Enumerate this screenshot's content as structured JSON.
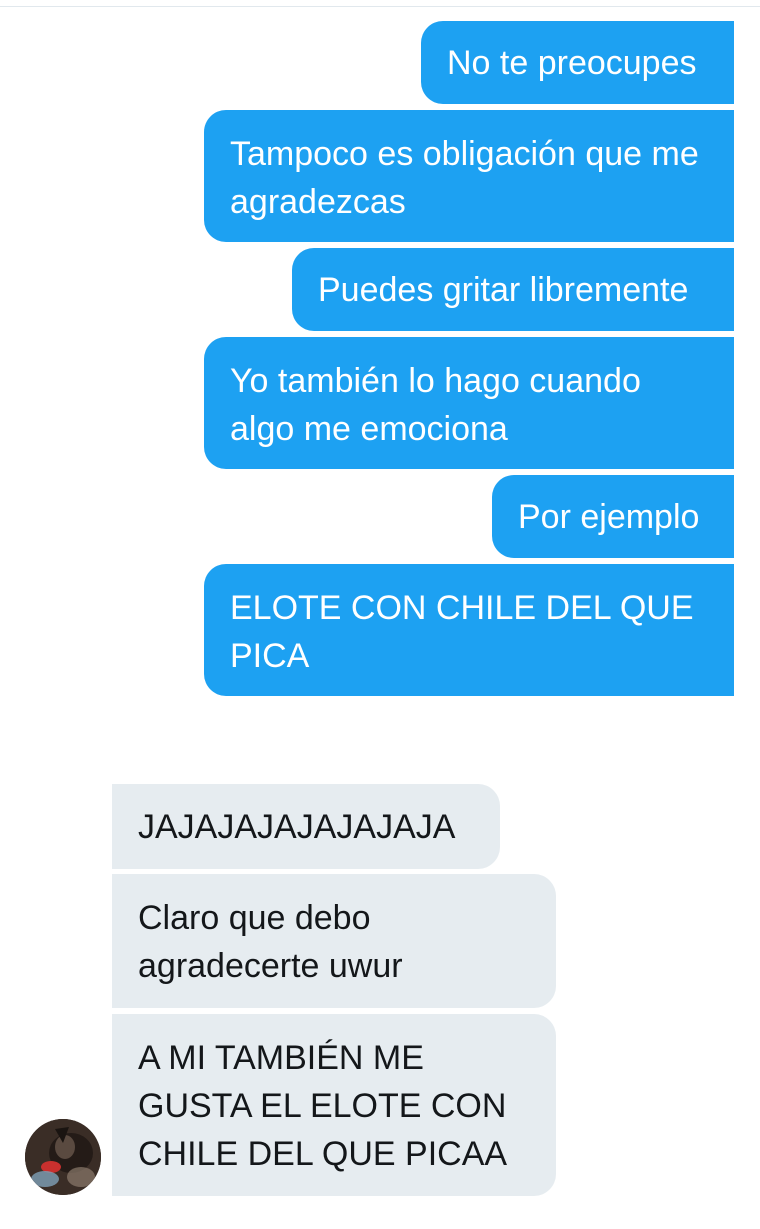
{
  "conversation": {
    "sent_messages": [
      "No te preocupes",
      "Tampoco es obligación que me agradezcas",
      "Puedes gritar libremente",
      "Yo también lo hago cuando algo me emociona",
      "Por ejemplo",
      "ELOTE CON CHILE DEL QUE PICA"
    ],
    "received_messages": [
      "JAJAJAJAJAJAJAJA",
      "Claro que debo agradecerte uwur",
      "A MI TAMBIÉN ME GUSTA EL ELOTE CON CHILE DEL QUE PICAA"
    ]
  },
  "colors": {
    "sent_bubble": "#1da1f2",
    "received_bubble": "#e6ecf0",
    "sent_text": "#ffffff",
    "received_text": "#14171a"
  },
  "icons": {
    "avatar": "contact-avatar-photo"
  }
}
